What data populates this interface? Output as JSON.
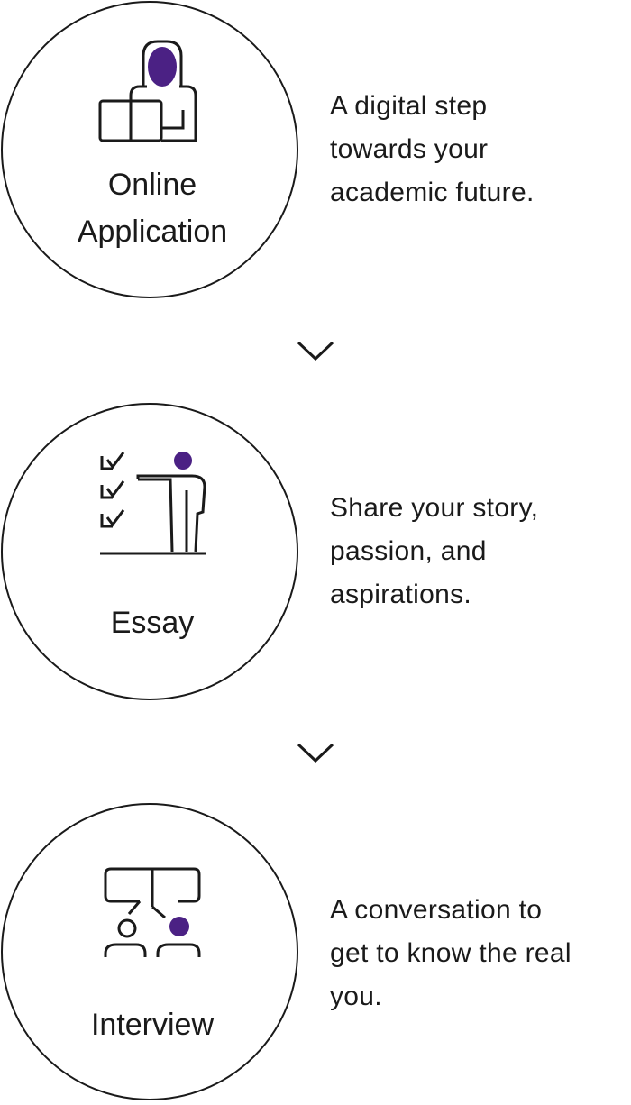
{
  "colors": {
    "accent": "#4b2184",
    "stroke": "#1a1a1a",
    "background": "#ffffff"
  },
  "steps": [
    {
      "icon": "person-at-laptop-icon",
      "title": "Online\nApplication",
      "description": "A digital step\ntowards your\nacademic future."
    },
    {
      "icon": "presenter-checklist-icon",
      "title": "Essay",
      "description": "Share your story,\npassion, and\naspirations."
    },
    {
      "icon": "two-people-conversation-icon",
      "title": "Interview",
      "description": "A conversation to\nget to know the real\nyou."
    }
  ],
  "connectors": [
    "chevron-down-icon",
    "chevron-down-icon"
  ]
}
